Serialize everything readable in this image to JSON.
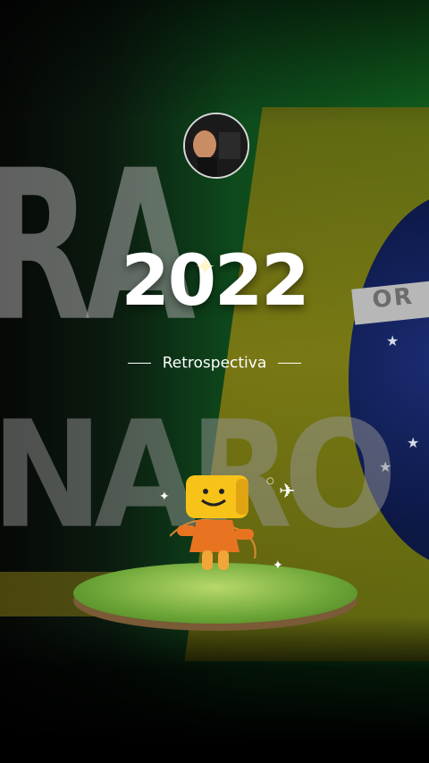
{
  "story": {
    "year": "2022",
    "subtitle": "Retrospectiva",
    "bg_banner_word_top": "RA",
    "bg_banner_word_bottom": "NARO",
    "flag_band_text": "OR"
  },
  "colors": {
    "green": "#11621f",
    "yellow": "#8b7f12",
    "blue": "#0c1744",
    "text": "#ffffff"
  },
  "icons": {
    "sparkle": "sparkle-icon",
    "paper_plane": "paper-plane-icon",
    "mascot": "smiley-mascot-icon"
  }
}
